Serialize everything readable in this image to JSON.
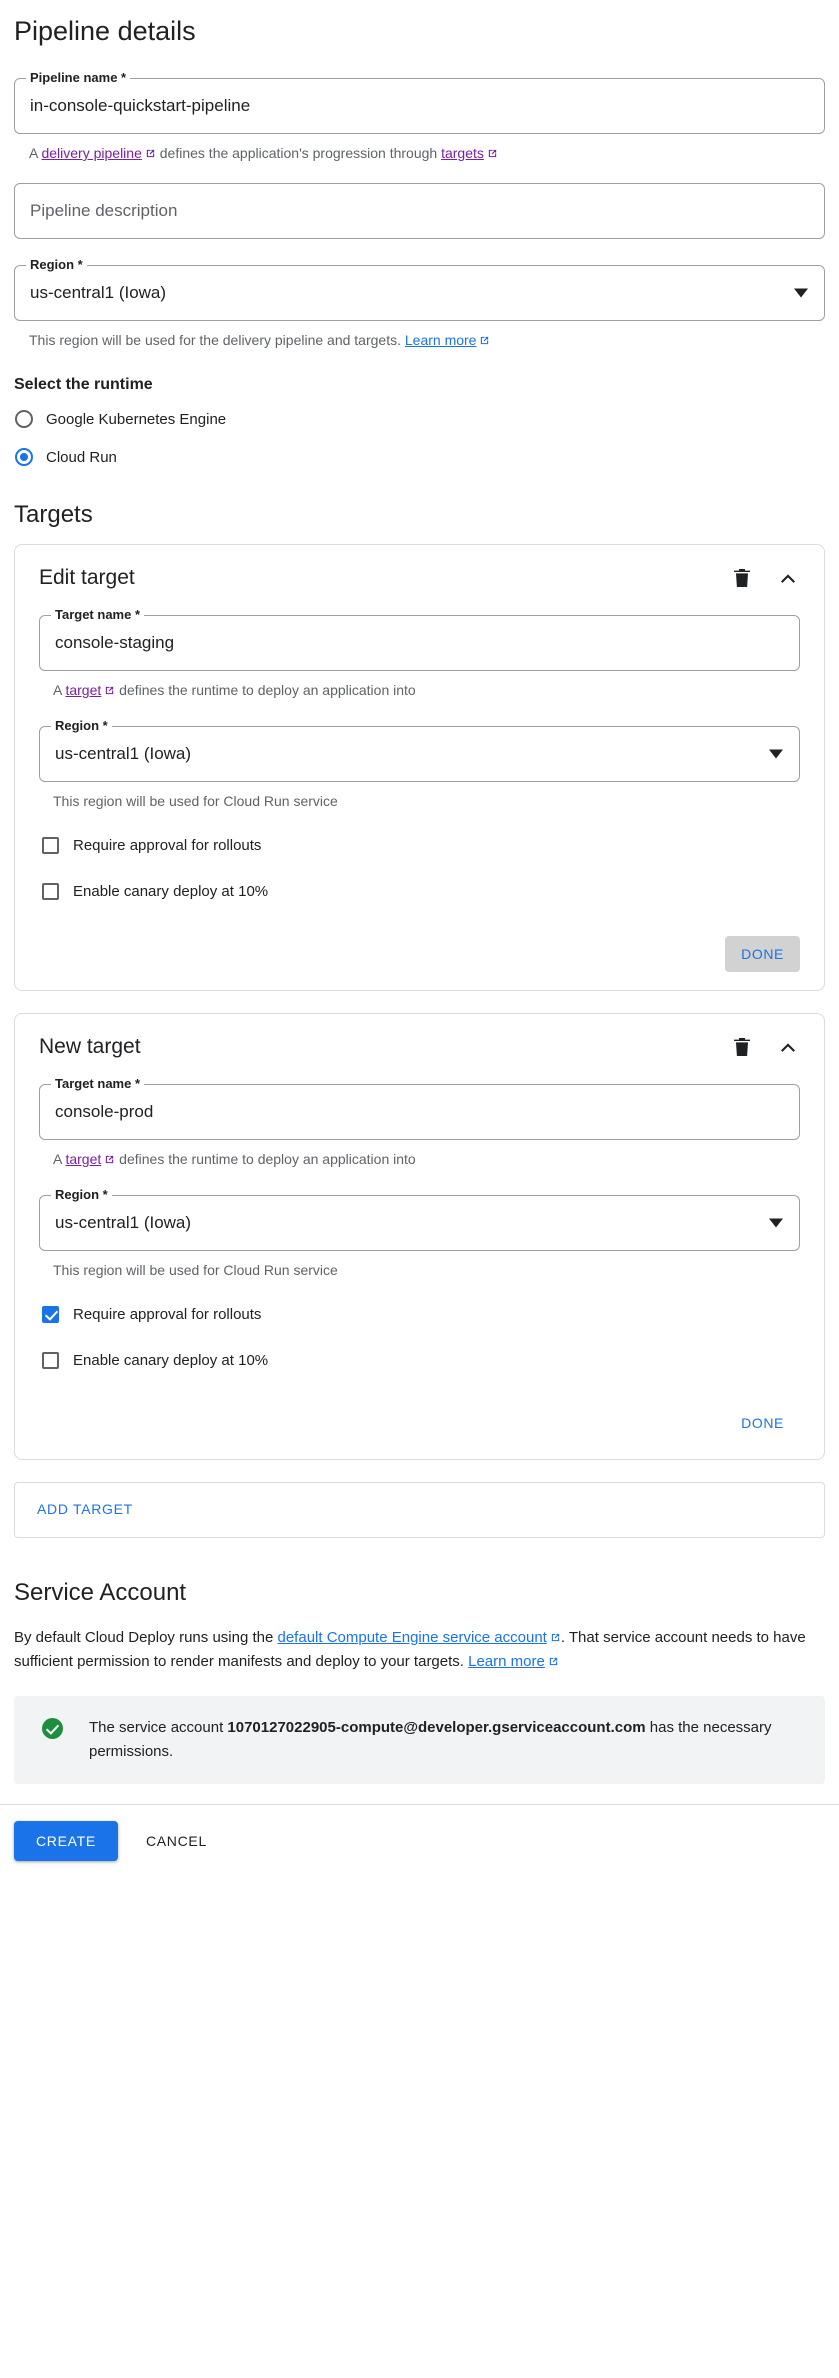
{
  "pipeline_details": {
    "heading": "Pipeline details",
    "name_field": {
      "legend": "Pipeline name *",
      "value": "in-console-quickstart-pipeline"
    },
    "name_helper": {
      "prefix": "A ",
      "link1": "delivery pipeline",
      "middle": " defines the application's progression through ",
      "link2": "targets"
    },
    "description_field": {
      "placeholder": "Pipeline description"
    },
    "region_field": {
      "legend": "Region *",
      "value": "us-central1 (Iowa)"
    },
    "region_helper": {
      "text": "This region will be used for the delivery pipeline and targets. ",
      "link": "Learn more"
    },
    "runtime": {
      "label": "Select the runtime",
      "options": [
        {
          "label": "Google Kubernetes Engine",
          "selected": false
        },
        {
          "label": "Cloud Run",
          "selected": true
        }
      ]
    }
  },
  "targets": {
    "heading": "Targets",
    "cards": [
      {
        "title": "Edit target",
        "delete_icon": "trash-icon",
        "collapse_icon": "chevron-up-icon",
        "name_field": {
          "legend": "Target name *",
          "value": "console-staging"
        },
        "name_helper": {
          "prefix": "A ",
          "link": "target",
          "suffix": " defines the runtime to deploy an application into"
        },
        "region_field": {
          "legend": "Region *",
          "value": "us-central1 (Iowa)"
        },
        "region_helper": "This region will be used for Cloud Run service",
        "checkboxes": [
          {
            "label": "Require approval for rollouts",
            "checked": false
          },
          {
            "label": "Enable canary deploy at 10%",
            "checked": false
          }
        ],
        "done_label": "DONE",
        "done_hovered": true
      },
      {
        "title": "New target",
        "delete_icon": "trash-icon",
        "collapse_icon": "chevron-up-icon",
        "name_field": {
          "legend": "Target name *",
          "value": "console-prod"
        },
        "name_helper": {
          "prefix": "A ",
          "link": "target",
          "suffix": " defines the runtime to deploy an application into"
        },
        "region_field": {
          "legend": "Region *",
          "value": "us-central1 (Iowa)"
        },
        "region_helper": "This region will be used for Cloud Run service",
        "checkboxes": [
          {
            "label": "Require approval for rollouts",
            "checked": true
          },
          {
            "label": "Enable canary deploy at 10%",
            "checked": false
          }
        ],
        "done_label": "DONE",
        "done_hovered": false
      }
    ],
    "add_target_label": "ADD TARGET"
  },
  "service_account": {
    "heading": "Service Account",
    "body": {
      "prefix": "By default Cloud Deploy runs using the ",
      "link1": "default Compute Engine service account",
      "middle": ". That service account needs to have sufficient permission to render manifests and deploy to your targets. ",
      "link2": "Learn more"
    },
    "banner": {
      "status_icon": "check-circle-icon",
      "prefix": "The service account ",
      "email": "1070127022905-compute@developer.gserviceaccount.com",
      "suffix": " has the necessary permissions."
    }
  },
  "footer": {
    "create_label": "CREATE",
    "cancel_label": "CANCEL"
  },
  "colors": {
    "accent_blue": "#1a73e8",
    "link_purple": "#7b1fa2",
    "success_green": "#1e8e3e",
    "border_gray": "#dadce0",
    "banner_bg": "#f1f3f4"
  }
}
